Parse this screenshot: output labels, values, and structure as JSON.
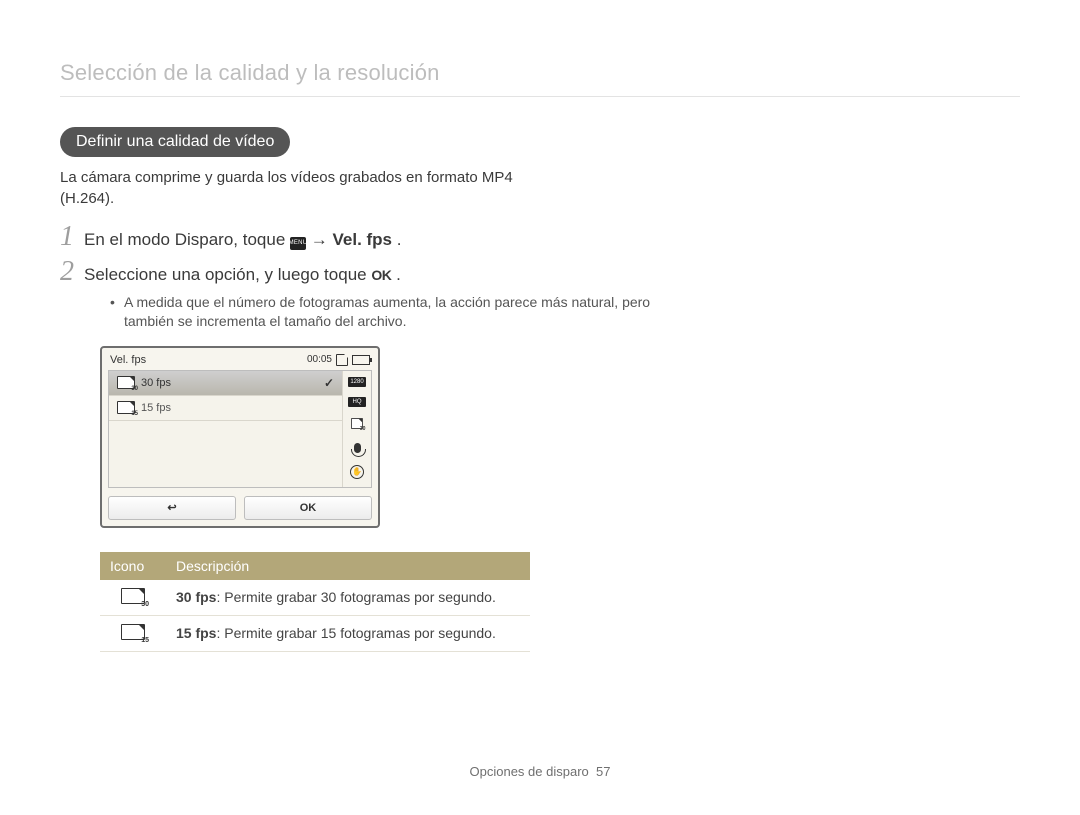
{
  "page": {
    "top_title": "Selección de la calidad y la resolución",
    "section_pill": "Definir una calidad de vídeo",
    "intro": "La cámara comprime y guarda los vídeos grabados en formato MP4 (H.264).",
    "step1_pre": "En el modo Disparo, toque ",
    "step1_menu_icon_text": "MENU",
    "step1_arrow": " → ",
    "step1_bold": "Vel. fps",
    "step1_end": ".",
    "step2_pre": "Seleccione una opción, y luego toque ",
    "step2_ok": "OK",
    "step2_end": " .",
    "bullet": "A medida que el número de fotogramas aumenta, la acción parece más natural, pero también se incrementa el tamaño del archivo.",
    "footer_label": "Opciones de disparo",
    "footer_page": "57"
  },
  "camera": {
    "title": "Vel. fps",
    "time": "00:05",
    "badge_top": "1280",
    "badge_hq": "HQ",
    "options": [
      {
        "label": "30 fps",
        "icon_sub": "30",
        "selected": true
      },
      {
        "label": "15 fps",
        "icon_sub": "15",
        "selected": false
      }
    ],
    "side_30_sub": "30",
    "ois_text": "OIS",
    "btn_back": "↩",
    "btn_ok": "OK"
  },
  "table": {
    "head_icon": "Icono",
    "head_desc": "Descripción",
    "rows": [
      {
        "icon_sub": "30",
        "bold": "30 fps",
        "rest": ": Permite grabar 30 fotogramas por segundo."
      },
      {
        "icon_sub": "15",
        "bold": "15 fps",
        "rest": ": Permite grabar 15 fotogramas por segundo."
      }
    ]
  }
}
